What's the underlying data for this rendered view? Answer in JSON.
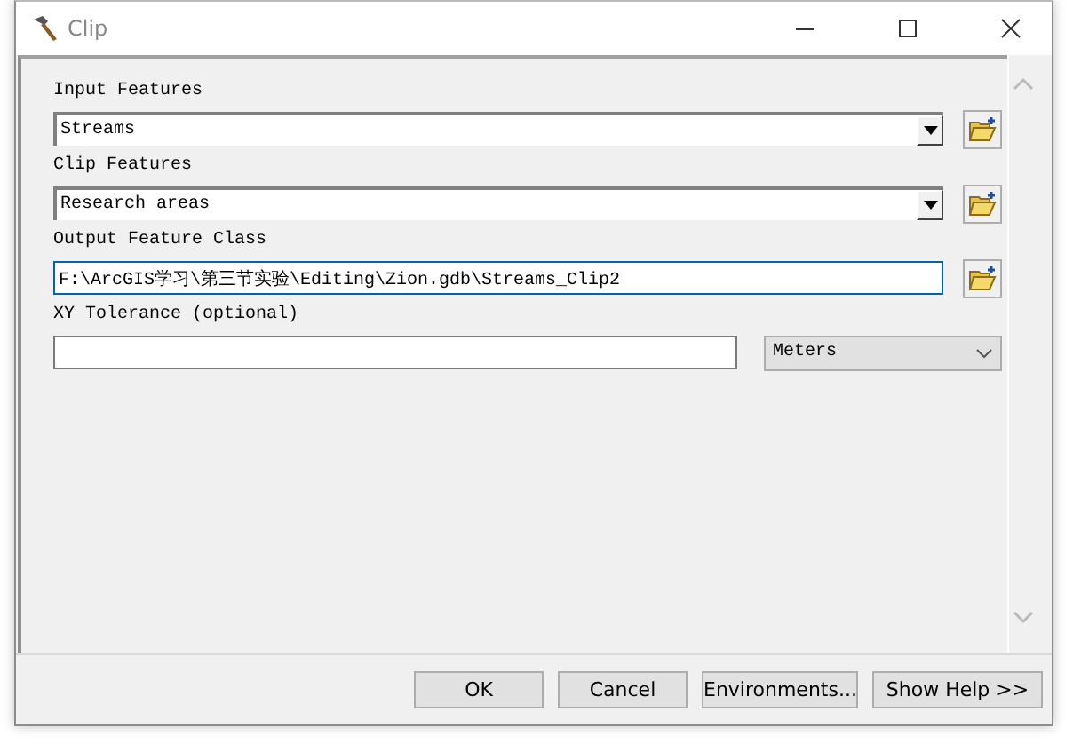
{
  "window": {
    "title": "Clip"
  },
  "parameters": [
    {
      "label": "Input Features",
      "kind": "combo",
      "value": "Streams",
      "focused": false,
      "browse": true
    },
    {
      "label": "Clip Features",
      "kind": "combo",
      "value": "Research areas",
      "focused": false,
      "browse": true
    },
    {
      "label": "Output Feature Class",
      "kind": "text",
      "value": "F:\\ArcGIS学习\\第三节实验\\Editing\\Zion.gdb\\Streams_Clip2",
      "focused": true,
      "browse": true
    },
    {
      "label": "XY Tolerance (optional)",
      "kind": "units",
      "unit": "Meters",
      "focused": false,
      "browse": false
    }
  ],
  "buttons": [
    "OK",
    "Cancel",
    "Environments...",
    "Show Help >>"
  ]
}
